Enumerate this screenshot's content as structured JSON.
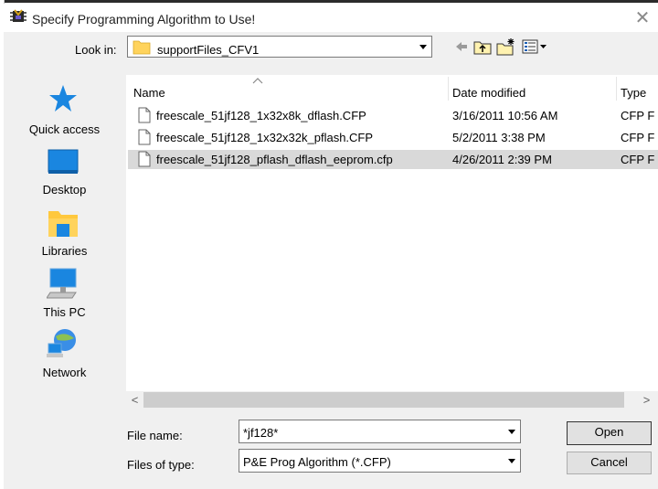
{
  "window": {
    "title": "Specify Programming Algorithm to Use!",
    "close_glyph": "✕"
  },
  "toolbar": {
    "look_in_label": "Look in:",
    "look_in_value": "supportFiles_CFV1",
    "icons": [
      "back-arrow-icon",
      "up-folder-icon",
      "new-folder-icon",
      "view-menu-icon"
    ]
  },
  "places": [
    {
      "label": "Quick access",
      "icon": "star-icon"
    },
    {
      "label": "Desktop",
      "icon": "desktop-icon"
    },
    {
      "label": "Libraries",
      "icon": "libraries-icon"
    },
    {
      "label": "This PC",
      "icon": "computer-icon"
    },
    {
      "label": "Network",
      "icon": "network-icon"
    }
  ],
  "columns": {
    "name": "Name",
    "date_modified": "Date modified",
    "type": "Type"
  },
  "files": [
    {
      "name": "freescale_51jf128_1x32x8k_dflash.CFP",
      "date": "3/16/2011 10:56 AM",
      "type": "CFP F",
      "selected": false
    },
    {
      "name": "freescale_51jf128_1x32x32k_pflash.CFP",
      "date": "5/2/2011 3:38 PM",
      "type": "CFP F",
      "selected": false
    },
    {
      "name": "freescale_51jf128_pflash_dflash_eeprom.cfp",
      "date": "4/26/2011 2:39 PM",
      "type": "CFP F",
      "selected": true
    }
  ],
  "scrollbar": {
    "left_glyph": "<",
    "right_glyph": ">"
  },
  "footer": {
    "file_name_label": "File name:",
    "file_name_value": "*jf128*",
    "files_of_type_label": "Files of type:",
    "files_of_type_value": "P&E Prog Algorithm (*.CFP)",
    "open_label": "Open",
    "cancel_label": "Cancel"
  },
  "colors": {
    "selection": "#d9d9d9",
    "dialog_bg": "#f0f0f0",
    "folder_yellow": "#ffd35c",
    "accent_blue": "#1a86e0"
  }
}
